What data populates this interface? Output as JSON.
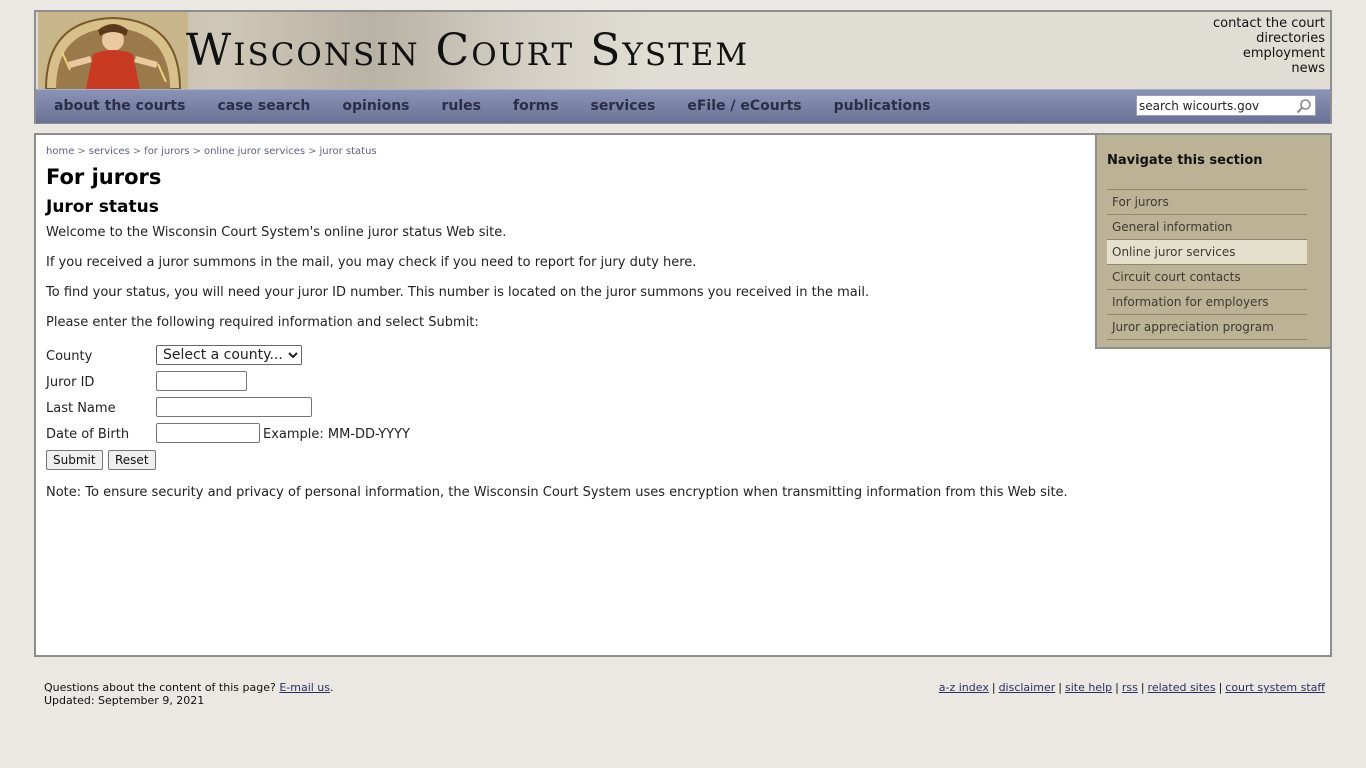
{
  "header": {
    "site_title": "Wisconsin Court System",
    "utility_links": [
      "contact the court",
      "directories",
      "employment",
      "news"
    ],
    "nav_items": [
      "about the courts",
      "case search",
      "opinions",
      "rules",
      "forms",
      "services",
      "eFile / eCourts",
      "publications"
    ],
    "search": {
      "placeholder": "search wicourts.gov"
    }
  },
  "breadcrumb": [
    "home",
    "services",
    "for jurors",
    "online juror services",
    "juror status"
  ],
  "breadcrumb_separator": ">",
  "main": {
    "page_title": "For jurors",
    "section_title": "Juror status",
    "paragraphs": [
      "Welcome to the Wisconsin Court System's online juror status Web site.",
      "If you received a juror summons in the mail, you may check if you need to report for jury duty here.",
      "To find your status, you will need your juror ID number. This number is located on the juror summons you received in the mail.",
      "Please enter the following required information and select Submit:"
    ],
    "form": {
      "county_label": "County",
      "county_selected": "Select a county...",
      "juror_id_label": "Juror ID",
      "last_name_label": "Last Name",
      "dob_label": "Date of Birth",
      "dob_example": "Example: MM-DD-YYYY",
      "submit_label": "Submit",
      "reset_label": "Reset"
    },
    "note": "Note: To ensure security and privacy of personal information, the Wisconsin Court System uses encryption when transmitting information from this Web site."
  },
  "sidenav": {
    "title": "Navigate this section",
    "items": [
      "For jurors",
      "General information",
      "Online juror services",
      "Circuit court contacts",
      "Information for employers",
      "Juror appreciation program"
    ],
    "active_item": "Online juror services"
  },
  "footer": {
    "question_text": "Questions about the content of this page?",
    "email_link": "E-mail us",
    "email_suffix": ".",
    "updated": "Updated: September 9, 2021",
    "links": [
      "a-z index",
      "disclaimer",
      "site help",
      "rss",
      "related sites",
      "court system staff"
    ],
    "link_separator": "|"
  },
  "colors": {
    "page_background": "#ebe7e3",
    "navbar": "#7a82a6",
    "sidenav": "#bcb397",
    "sidenav_active": "#e5e0cc"
  },
  "icons": {
    "search_button": "magnifier-icon",
    "header_seal": "justice-figure-icon"
  }
}
